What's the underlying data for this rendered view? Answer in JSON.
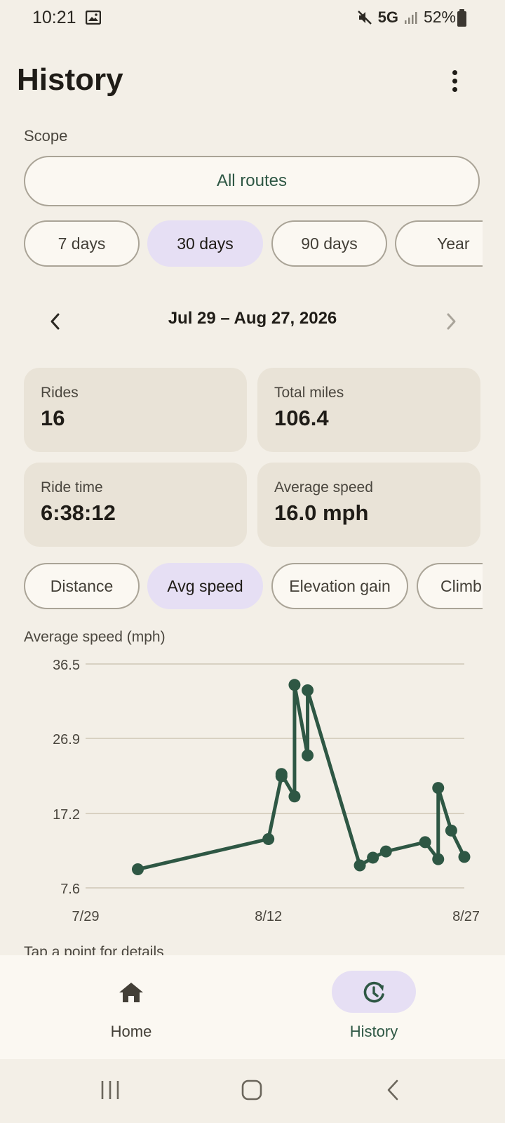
{
  "status_bar": {
    "time": "10:21",
    "network": "5G",
    "battery": "52%"
  },
  "header": {
    "title": "History"
  },
  "scope": {
    "label": "Scope",
    "value": "All routes"
  },
  "range_chips": [
    {
      "label": "7 days",
      "selected": false
    },
    {
      "label": "30 days",
      "selected": true
    },
    {
      "label": "90 days",
      "selected": false
    },
    {
      "label": "Year",
      "selected": false
    }
  ],
  "date_range": {
    "label": "Jul 29 – Aug 27, 2026"
  },
  "stats": [
    {
      "label": "Rides",
      "value": "16"
    },
    {
      "label": "Total miles",
      "value": "106.4"
    },
    {
      "label": "Ride time",
      "value": "6:38:12"
    },
    {
      "label": "Average speed",
      "value": "16.0 mph"
    }
  ],
  "metric_chips": [
    {
      "label": "Distance",
      "selected": false
    },
    {
      "label": "Avg speed",
      "selected": true
    },
    {
      "label": "Elevation gain",
      "selected": false
    },
    {
      "label": "Climb",
      "selected": false
    }
  ],
  "chart_data": {
    "type": "line",
    "ylabel": "Average speed (mph)",
    "xlabel": "",
    "x_ticks": [
      "7/29",
      "8/12",
      "8/27"
    ],
    "x_tick_days": [
      0,
      14,
      29
    ],
    "y_ticks": [
      7.6,
      17.2,
      26.9,
      36.5
    ],
    "ylim": [
      7.6,
      36.5
    ],
    "grid": true,
    "series": [
      {
        "x_days": [
          4,
          14,
          15,
          15,
          16,
          16,
          17,
          17,
          21,
          22,
          23,
          26,
          27,
          27,
          28,
          29
        ],
        "values": [
          10.0,
          13.9,
          22.0,
          22.3,
          19.4,
          33.8,
          24.7,
          33.1,
          10.5,
          11.5,
          12.3,
          13.5,
          11.3,
          20.5,
          15.0,
          11.6
        ],
        "color": "#2e5744"
      }
    ]
  },
  "chart_hint": "Tap a point for details",
  "bottom_nav": {
    "items": [
      {
        "label": "Home",
        "active": false
      },
      {
        "label": "History",
        "active": true
      }
    ]
  },
  "colors": {
    "accent": "#2e5744",
    "selected_chip": "#e6dff4",
    "card": "#e9e3d7",
    "background": "#f3efe7"
  }
}
